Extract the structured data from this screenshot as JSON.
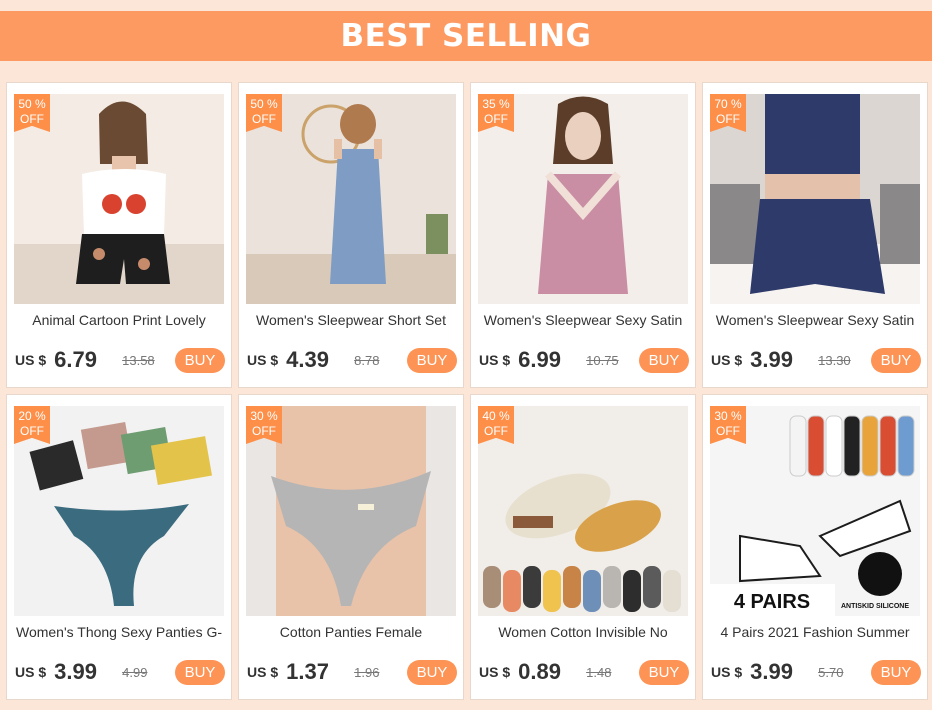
{
  "banner": {
    "title": "BEST SELLING"
  },
  "products": [
    {
      "discount": "50 %",
      "off": "OFF",
      "title": "Animal Cartoon Print Lovely",
      "currency": "US $",
      "price": "6.79",
      "old_price": "13.58",
      "buy": "BUY",
      "image": "floral-cami-pajama",
      "palette": [
        "#f4ece4",
        "#ffffff",
        "#1e1e1e"
      ]
    },
    {
      "discount": "50 %",
      "off": "OFF",
      "title": "Women's Sleepwear Short Set",
      "currency": "US $",
      "price": "4.39",
      "old_price": "8.78",
      "buy": "BUY",
      "image": "blue-cami-short-set",
      "palette": [
        "#ebe3db",
        "#7f9cc4",
        "#d8c9b8"
      ]
    },
    {
      "discount": "35 %",
      "off": "OFF",
      "title": "Women's Sleepwear Sexy Satin",
      "currency": "US $",
      "price": "6.99",
      "old_price": "10.75",
      "buy": "BUY",
      "image": "pink-satin-cami",
      "palette": [
        "#f3eee9",
        "#c98da4",
        "#f0e0d8"
      ]
    },
    {
      "discount": "70 %",
      "off": "OFF",
      "title": "Women's Sleepwear Sexy Satin",
      "currency": "US $",
      "price": "3.99",
      "old_price": "13.30",
      "buy": "BUY",
      "image": "navy-satin-set",
      "palette": [
        "#dcd6d2",
        "#2d3a6a",
        "#f6f3f1"
      ]
    },
    {
      "discount": "20 %",
      "off": "OFF",
      "title": "Women's Thong Sexy Panties G-",
      "currency": "US $",
      "price": "3.99",
      "old_price": "4.99",
      "buy": "BUY",
      "image": "colorful-thongs",
      "palette": [
        "#f2f2f2",
        "#3b6b7f",
        "#e3c34a"
      ]
    },
    {
      "discount": "30 %",
      "off": "OFF",
      "title": "Cotton Panties Female",
      "currency": "US $",
      "price": "1.37",
      "old_price": "1.96",
      "buy": "BUY",
      "image": "grey-cotton-panty",
      "palette": [
        "#e9e6e3",
        "#b5b5b5",
        "#e7b39a"
      ]
    },
    {
      "discount": "40 %",
      "off": "OFF",
      "title": "Women Cotton Invisible No",
      "currency": "US $",
      "price": "0.89",
      "old_price": "1.48",
      "buy": "BUY",
      "image": "invisible-socks",
      "palette": [
        "#f1eeea",
        "#d9a24a",
        "#e8e0cf"
      ]
    },
    {
      "discount": "30 %",
      "off": "OFF",
      "title": "4 Pairs 2021 Fashion Summer",
      "currency": "US $",
      "price": "3.99",
      "old_price": "5.70",
      "buy": "BUY",
      "image": "cartoon-ankle-socks",
      "palette": [
        "#f5f5f5",
        "#1c1c1c",
        "#ffffff"
      ],
      "image_text": [
        "4 PAIRS",
        "ANTISKID SILICONE"
      ]
    }
  ]
}
